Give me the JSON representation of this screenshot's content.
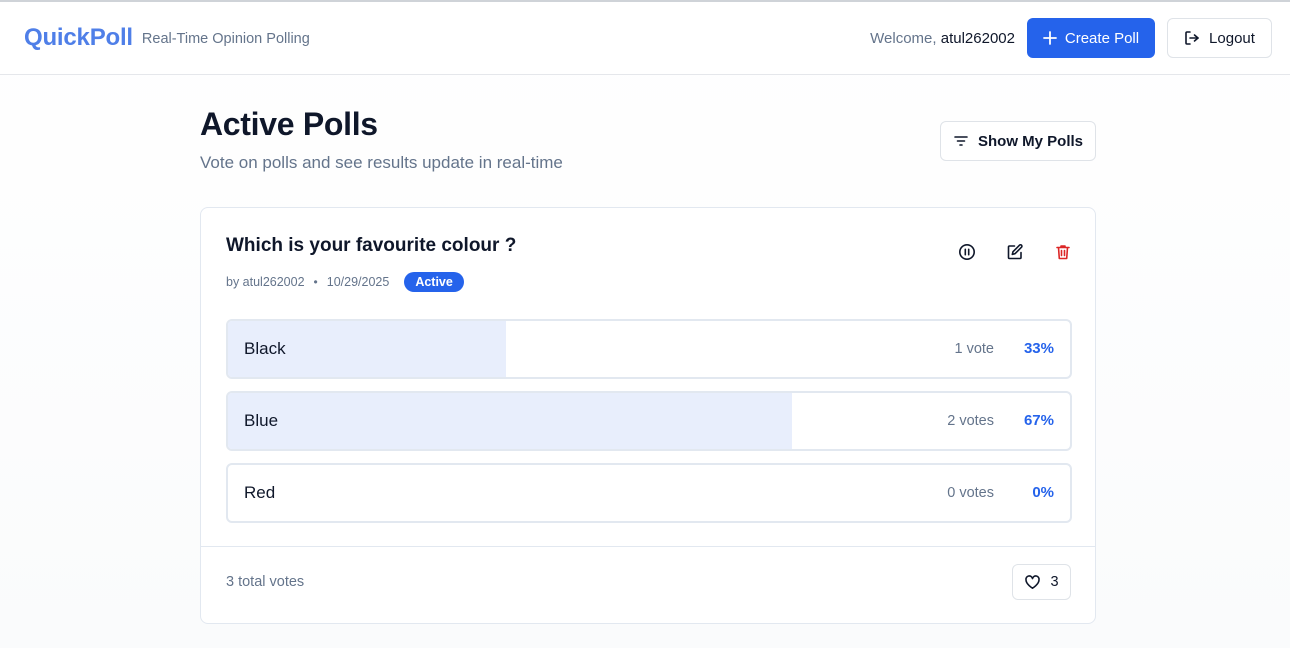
{
  "header": {
    "brand": "QuickPoll",
    "tagline": "Real-Time Opinion Polling",
    "welcome_prefix": "Welcome,",
    "username": "atul262002",
    "create_label": "Create Poll",
    "logout_label": "Logout"
  },
  "page": {
    "title": "Active Polls",
    "subtitle": "Vote on polls and see results update in real-time",
    "filter_label": "Show My Polls"
  },
  "poll": {
    "question": "Which is your favourite colour ?",
    "author": "by atul262002",
    "separator": "•",
    "date": "10/29/2025",
    "status": "Active",
    "options": [
      {
        "label": "Black",
        "votes": "1 vote",
        "percent": "33%",
        "share": 0.33
      },
      {
        "label": "Blue",
        "votes": "2 votes",
        "percent": "67%",
        "share": 0.67
      },
      {
        "label": "Red",
        "votes": "0 votes",
        "percent": "0%",
        "share": 0
      }
    ],
    "total": "3 total votes",
    "likes": "3",
    "icons": [
      "pause-icon",
      "edit-icon",
      "trash-icon",
      "heart-icon"
    ]
  },
  "colors": {
    "accent": "#2563eb",
    "brand": "#4f7fe8",
    "bar_fill": "#e8eefc",
    "danger": "#dc2626",
    "muted": "#64748b"
  }
}
